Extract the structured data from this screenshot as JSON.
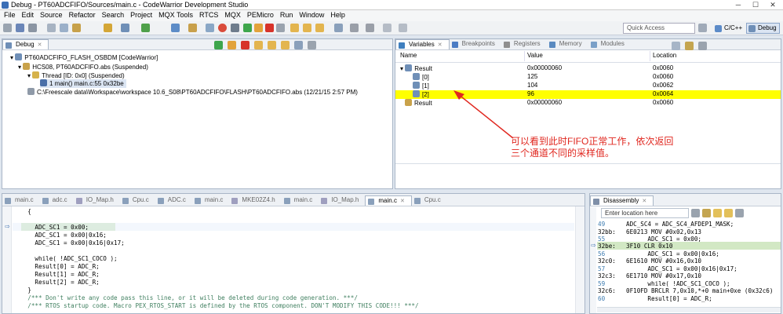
{
  "window": {
    "title": "Debug - PT60ADCFIFO/Sources/main.c - CodeWarrior Development Studio",
    "buttons": [
      "─",
      "☐",
      "✕"
    ]
  },
  "menu": [
    "File",
    "Edit",
    "Source",
    "Refactor",
    "Search",
    "Project",
    "MQX Tools",
    "RTCS",
    "MQX",
    "PEMicro",
    "Run",
    "Window",
    "Help"
  ],
  "toolbar": {
    "quick_access": "Quick Access",
    "perspective_c": "C/C++",
    "perspective_debug": "Debug"
  },
  "debug_view": {
    "tab": "Debug",
    "tree": [
      "PT60ADCFIFO_FLASH_OSBDM [CodeWarrior]",
      "HCS08, PT60ADCFIFO.abs (Suspended)",
      "Thread [ID: 0x0] (Suspended)",
      "1 main() main.c:55 0x32be",
      "C:\\Freescale data\\Workspace\\workspace 10.6_S08\\PT60ADCFIFO\\FLASH\\PT60ADCFIFO.abs (12/21/15 2:57 PM)"
    ]
  },
  "variables_view": {
    "tabs": [
      "Variables",
      "Breakpoints",
      "Registers",
      "Memory",
      "Modules"
    ],
    "columns": [
      "Name",
      "Value",
      "Location"
    ],
    "rows": [
      {
        "name": "Result",
        "value": "0x00000060",
        "location": "0x0060"
      },
      {
        "name": "[0]",
        "value": "125",
        "location": "0x0060"
      },
      {
        "name": "[1]",
        "value": "104",
        "location": "0x0062"
      },
      {
        "name": "[2]",
        "value": "96",
        "location": "0x0064"
      },
      {
        "name": "Result",
        "value": "0x00000060",
        "location": "0x0060"
      }
    ],
    "highlight_color": "#ffff00"
  },
  "annotation": {
    "line1": "可以看到此时FIFO正常工作，依次返回",
    "line2": "三个通道不同的采样值。",
    "color": "#e0271f"
  },
  "editor": {
    "tabs": [
      "main.c",
      "adc.c",
      "IO_Map.h",
      "Cpu.c",
      "ADC.c",
      "main.c",
      "MKE02Z4.h",
      "main.c",
      "IO_Map.h",
      "main.c",
      "Cpu.c"
    ],
    "lines": [
      "    {",
      "",
      "      ADC_SC1 = 0x00;",
      "      ADC_SC1 = 0x00|0x16;",
      "      ADC_SC1 = 0x00|0x16|0x17;",
      "",
      "      while( !ADC_SC1_COCO );",
      "      Result[0] = ADC_R;",
      "      Result[1] = ADC_R;",
      "      Result[2] = ADC_R;",
      "    }",
      "    /*** Don't write any code pass this line, or it will be deleted during code generation. ***/",
      "    /*** RTOS startup code. Macro PEX_RTOS_START is defined by the RTOS component. DON'T MODIFY THIS CODE!!! ***/"
    ]
  },
  "disassembly": {
    "tab": "Disassembly",
    "location_placeholder": "Enter location here",
    "lines": [
      {
        "addr": "49",
        "code": "ADC_SC4 = ADC_SC4_AFDEP1_MASK;"
      },
      {
        "addr": "32bb:",
        "code": "6E0213 MOV #0x02,0x13"
      },
      {
        "addr": "55",
        "code": "      ADC_SC1 = 0x00;"
      },
      {
        "addr": "32be:",
        "code": "3F10 CLR 0x10"
      },
      {
        "addr": "56",
        "code": "      ADC_SC1 = 0x00|0x16;"
      },
      {
        "addr": "32c0:",
        "code": "6E1610 MOV #0x16,0x10"
      },
      {
        "addr": "57",
        "code": "      ADC_SC1 = 0x00|0x16|0x17;"
      },
      {
        "addr": "32c3:",
        "code": "6E1710 MOV #0x17,0x10"
      },
      {
        "addr": "59",
        "code": "      while( !ADC_SC1_COCO );"
      },
      {
        "addr": "32c6:",
        "code": "0F10FD BRCLR 7,0x10,*+0 main+0xe (0x32c6)"
      },
      {
        "addr": "60",
        "code": "      Result[0] = ADC_R;"
      }
    ]
  }
}
